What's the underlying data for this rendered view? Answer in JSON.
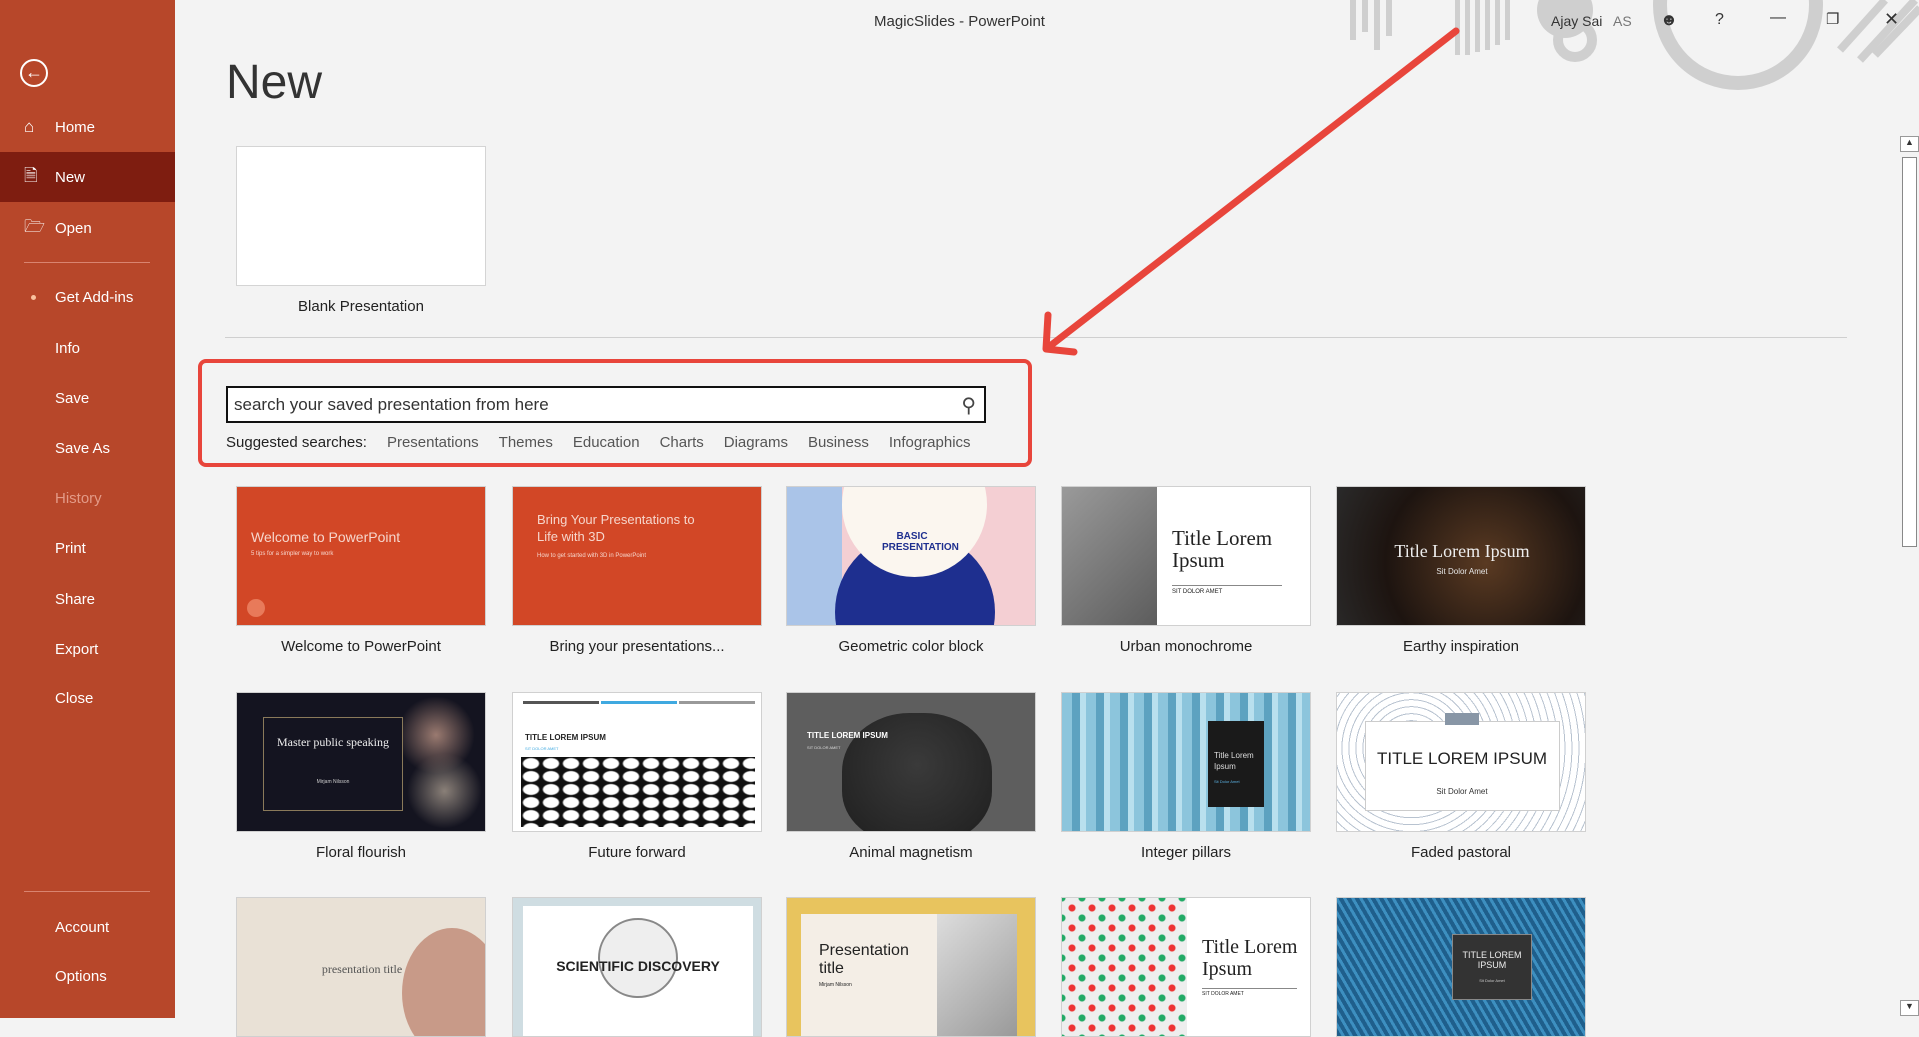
{
  "window": {
    "title": "MagicSlides  -  PowerPoint",
    "user_name": "Ajay Sai",
    "user_initials": "AS"
  },
  "sidebar": {
    "items": [
      {
        "label": "Home",
        "icon": "home-icon"
      },
      {
        "label": "New",
        "icon": "new-file-icon",
        "selected": true
      },
      {
        "label": "Open",
        "icon": "folder-icon"
      },
      {
        "label": "Get Add-ins"
      },
      {
        "label": "Info"
      },
      {
        "label": "Save"
      },
      {
        "label": "Save As"
      },
      {
        "label": "History",
        "disabled": true
      },
      {
        "label": "Print"
      },
      {
        "label": "Share"
      },
      {
        "label": "Export"
      },
      {
        "label": "Close"
      },
      {
        "label": "Account"
      },
      {
        "label": "Options"
      }
    ]
  },
  "main": {
    "heading": "New",
    "blank_label": "Blank Presentation",
    "search": {
      "value": "search your saved presentation from here"
    },
    "suggested_label": "Suggested searches:",
    "suggested": [
      "Presentations",
      "Themes",
      "Education",
      "Charts",
      "Diagrams",
      "Business",
      "Infographics"
    ],
    "templates": [
      {
        "name": "Welcome to PowerPoint",
        "t1": "Welcome to PowerPoint",
        "t2": "5 tips for a simpler way to work"
      },
      {
        "name": "Bring your presentations...",
        "t1": "Bring Your Presentations to Life with 3D",
        "t2": "How to get started with 3D in PowerPoint"
      },
      {
        "name": "Geometric color block",
        "t1": "BASIC PRESENTATION"
      },
      {
        "name": "Urban monochrome",
        "t1": "Title Lorem Ipsum",
        "t2": "SIT DOLOR AMET"
      },
      {
        "name": "Earthy inspiration",
        "t1": "Title Lorem Ipsum",
        "t2": "Sit Dolor Amet"
      },
      {
        "name": "Floral flourish",
        "t1": "Master public speaking",
        "t2": "Mirjam Nilsson"
      },
      {
        "name": "Future forward",
        "t1": "TITLE LOREM IPSUM",
        "t2": "SIT DOLOR AMET"
      },
      {
        "name": "Animal magnetism",
        "t1": "TITLE LOREM IPSUM",
        "t2": "SIT DOLOR AMET"
      },
      {
        "name": "Integer pillars",
        "t1": "Title Lorem Ipsum",
        "t2": "Sit Dolor Amet"
      },
      {
        "name": "Faded pastoral",
        "t1": "TITLE LOREM IPSUM",
        "t2": "Sit Dolor Amet"
      },
      {
        "name": "",
        "t1": "presentation title"
      },
      {
        "name": "",
        "t1": "SCIENTIFIC DISCOVERY"
      },
      {
        "name": "",
        "t1": "Presentation title",
        "t2": "Mirjam Nilsson"
      },
      {
        "name": "",
        "t1": "Title Lorem Ipsum",
        "t2": "SIT DOLOR AMET"
      },
      {
        "name": "",
        "t1": "TITLE LOREM IPSUM",
        "t2": "Sit Dolor Amet"
      }
    ]
  },
  "colors": {
    "sidebar": "#b7472a",
    "selected": "#7e1d10",
    "annotation": "#e8453b"
  }
}
